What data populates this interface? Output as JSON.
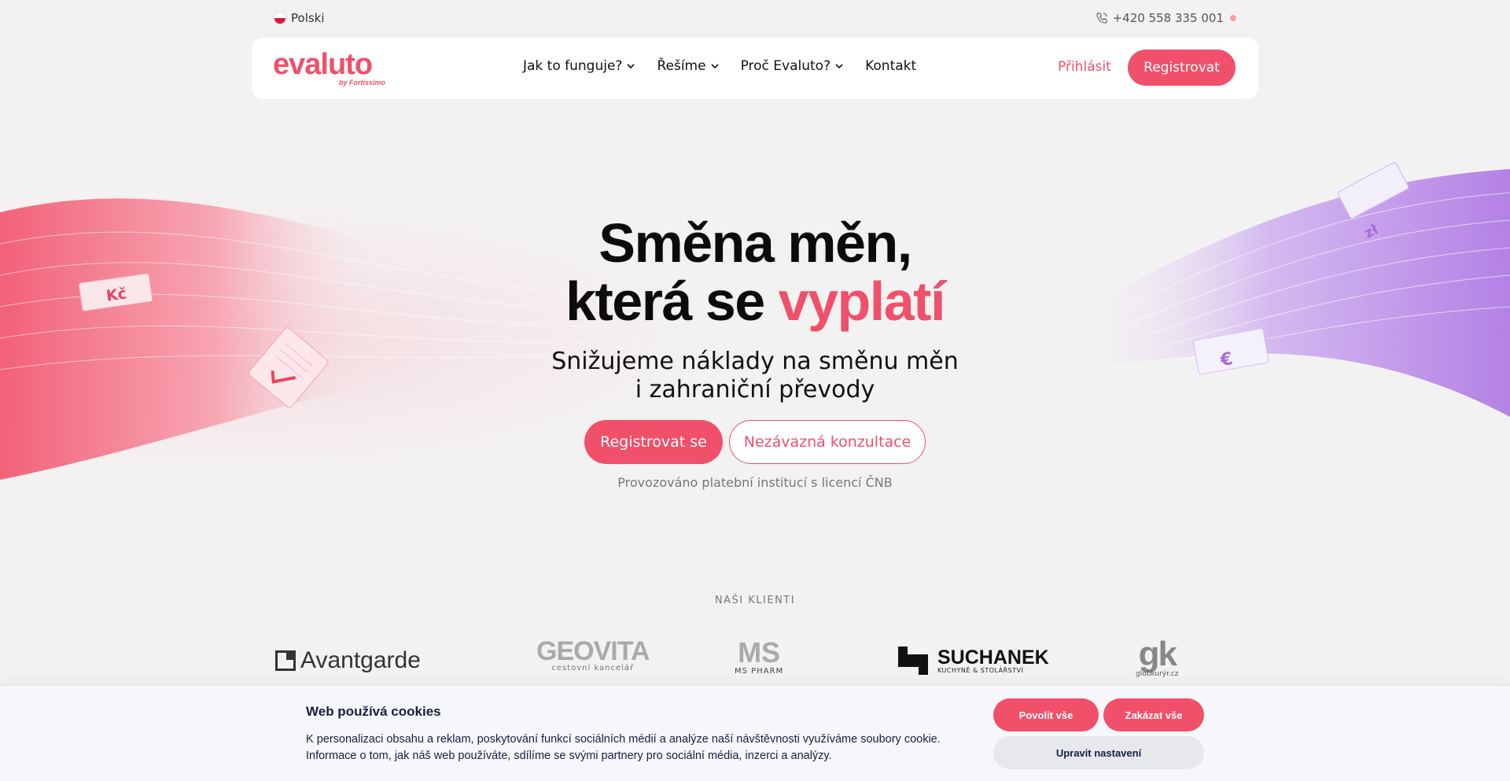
{
  "topbar": {
    "language": "Polski",
    "phone": "+420 558 335 001"
  },
  "nav": {
    "logo": "evaluto",
    "logo_sub": "by Fortissimo",
    "menu": [
      {
        "label": "Jak to funguje?",
        "dropdown": true
      },
      {
        "label": "Řešíme",
        "dropdown": true
      },
      {
        "label": "Proč Evaluto?",
        "dropdown": true
      },
      {
        "label": "Kontakt",
        "dropdown": false
      }
    ],
    "login": "Přihlásit",
    "register": "Registrovat"
  },
  "hero": {
    "title_line1": "Směna měn,",
    "title_line2_prefix": "která se ",
    "title_line2_accent": "vyplatí",
    "subtitle_line1": "Snižujeme náklady na směnu měn",
    "subtitle_line2": "i zahraniční převody",
    "cta_primary": "Registrovat se",
    "cta_secondary": "Nezávazná konzultace",
    "license": "Provozováno platební institucí s licencí ČNB",
    "notes": {
      "czk": "Kč",
      "pln": "zł",
      "eur": "€"
    }
  },
  "clients": {
    "label": "NAŠI KLIENTI",
    "avantgarde": "Avantgarde",
    "geovita": "GEOVITA",
    "geovita_sub": "cestovní kancelář",
    "ms": "MS",
    "ms_sub": "MS PHARM",
    "suchanek": "SUCHANEK",
    "suchanek_sub": "KUCHYNĚ & STOLÁŘSTVÍ",
    "gk": "gk",
    "gk_sub": "globkurýr.cz"
  },
  "cookie": {
    "title": "Web používá cookies",
    "text": "K personalizaci obsahu a reklam, poskytování funkcí sociálních médií a analýze naší návštěvnosti využíváme soubory cookie. Informace o tom, jak náš web používáte, sdílíme se svými partnery pro sociální média, inzerci a analýzy.",
    "allow_all": "Povolit vše",
    "deny_all": "Zakázat vše",
    "edit": "Upravit nastavení"
  },
  "colors": {
    "accent": "#f0506a",
    "purple": "#b58ae6",
    "background": "#f3f2f2",
    "cookie_text": "#152042"
  }
}
